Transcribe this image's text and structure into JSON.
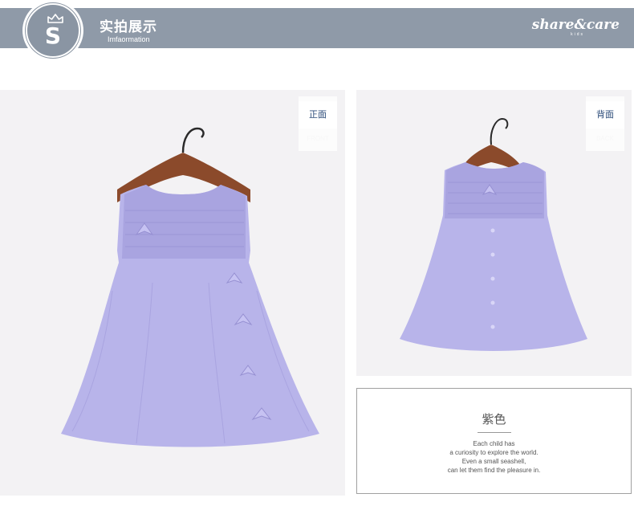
{
  "header": {
    "logo_letter": "S",
    "title": "实拍展示",
    "subtitle": "Imfaormation",
    "brand": "share&care",
    "brand_sub": "kids"
  },
  "front_photo": {
    "label_cn": "正面",
    "label_en": "FRONT"
  },
  "back_photo": {
    "label_cn": "背面",
    "label_en": "BACK"
  },
  "info": {
    "color_name": "紫色",
    "lines": [
      "Each child has",
      "a curiosity to explore the world.",
      "Even a small seashell,",
      "can let them find the pleasure in."
    ]
  },
  "colors": {
    "header": "#8f9aa8",
    "dress": "#b8b4ea",
    "hanger": "#8b4a2b",
    "label_text": "#2a4a78"
  },
  "icons": [
    "crown-icon",
    "hanger-icon"
  ]
}
